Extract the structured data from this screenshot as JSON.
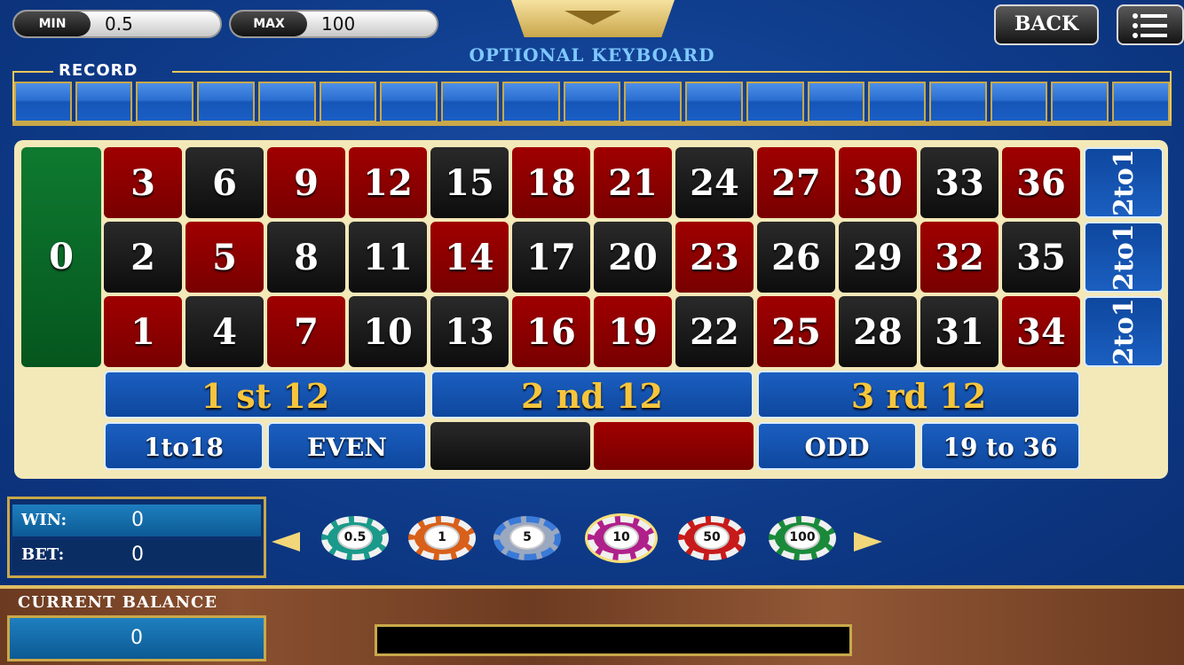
{
  "limits": {
    "min_label": "MIN",
    "min_value": "0.5",
    "max_label": "MAX",
    "max_value": "100"
  },
  "header": {
    "keyboard_label": "OPTIONAL KEYBOARD",
    "back_label": "BACK",
    "menu_icon": "menu-icon"
  },
  "record": {
    "title": "RECORD"
  },
  "board": {
    "zero": "0",
    "rows": [
      [
        {
          "n": "3",
          "c": "red"
        },
        {
          "n": "6",
          "c": "black"
        },
        {
          "n": "9",
          "c": "red"
        },
        {
          "n": "12",
          "c": "red"
        },
        {
          "n": "15",
          "c": "black"
        },
        {
          "n": "18",
          "c": "red"
        },
        {
          "n": "21",
          "c": "red"
        },
        {
          "n": "24",
          "c": "black"
        },
        {
          "n": "27",
          "c": "red"
        },
        {
          "n": "30",
          "c": "red"
        },
        {
          "n": "33",
          "c": "black"
        },
        {
          "n": "36",
          "c": "red"
        }
      ],
      [
        {
          "n": "2",
          "c": "black"
        },
        {
          "n": "5",
          "c": "red"
        },
        {
          "n": "8",
          "c": "black"
        },
        {
          "n": "11",
          "c": "black"
        },
        {
          "n": "14",
          "c": "red"
        },
        {
          "n": "17",
          "c": "black"
        },
        {
          "n": "20",
          "c": "black"
        },
        {
          "n": "23",
          "c": "red"
        },
        {
          "n": "26",
          "c": "black"
        },
        {
          "n": "29",
          "c": "black"
        },
        {
          "n": "32",
          "c": "red"
        },
        {
          "n": "35",
          "c": "black"
        }
      ],
      [
        {
          "n": "1",
          "c": "red"
        },
        {
          "n": "4",
          "c": "black"
        },
        {
          "n": "7",
          "c": "red"
        },
        {
          "n": "10",
          "c": "black"
        },
        {
          "n": "13",
          "c": "black"
        },
        {
          "n": "16",
          "c": "red"
        },
        {
          "n": "19",
          "c": "red"
        },
        {
          "n": "22",
          "c": "black"
        },
        {
          "n": "25",
          "c": "red"
        },
        {
          "n": "28",
          "c": "black"
        },
        {
          "n": "31",
          "c": "black"
        },
        {
          "n": "34",
          "c": "red"
        }
      ]
    ],
    "column_bets": [
      "2to1",
      "2to1",
      "2to1"
    ],
    "dozens": [
      "1 st 12",
      "2 nd 12",
      "3 rd 12"
    ],
    "even_bets": [
      "1to18",
      "EVEN",
      "",
      "",
      "ODD",
      "19 to 36"
    ]
  },
  "stats": {
    "win_label": "WIN:",
    "win_value": "0",
    "bet_label": "BET:",
    "bet_value": "0"
  },
  "chips": [
    {
      "value": "0.5",
      "color": "#1a9a8a",
      "stripe": "#f0f0f0"
    },
    {
      "value": "1",
      "color": "#d8601a",
      "stripe": "#f0f0f0"
    },
    {
      "value": "5",
      "color": "#9aa8c0",
      "stripe": "#3a7ad8"
    },
    {
      "value": "10",
      "color": "#b0208a",
      "stripe": "#f0f0f0"
    },
    {
      "value": "50",
      "color": "#c81a1a",
      "stripe": "#f0f0f0"
    },
    {
      "value": "100",
      "color": "#1a8a3a",
      "stripe": "#f0f0f0"
    }
  ],
  "selected_chip": "10",
  "balance": {
    "title": "CURRENT BALANCE",
    "value": "0",
    "message": ""
  }
}
